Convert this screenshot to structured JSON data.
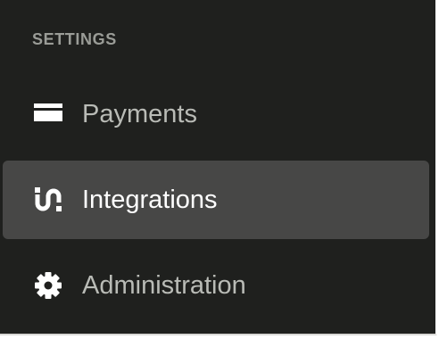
{
  "sidebar": {
    "section_title": "SETTINGS",
    "items": [
      {
        "label": "Payments",
        "icon": "card-icon",
        "active": false
      },
      {
        "label": "Integrations",
        "icon": "integrations-icon",
        "active": true
      },
      {
        "label": "Administration",
        "icon": "gear-icon",
        "active": false
      }
    ]
  },
  "colors": {
    "background": "#1f201e",
    "active_background": "#474746",
    "text": "#b9bbb6",
    "active_text": "#ffffff",
    "section_text": "#9a9c97"
  }
}
